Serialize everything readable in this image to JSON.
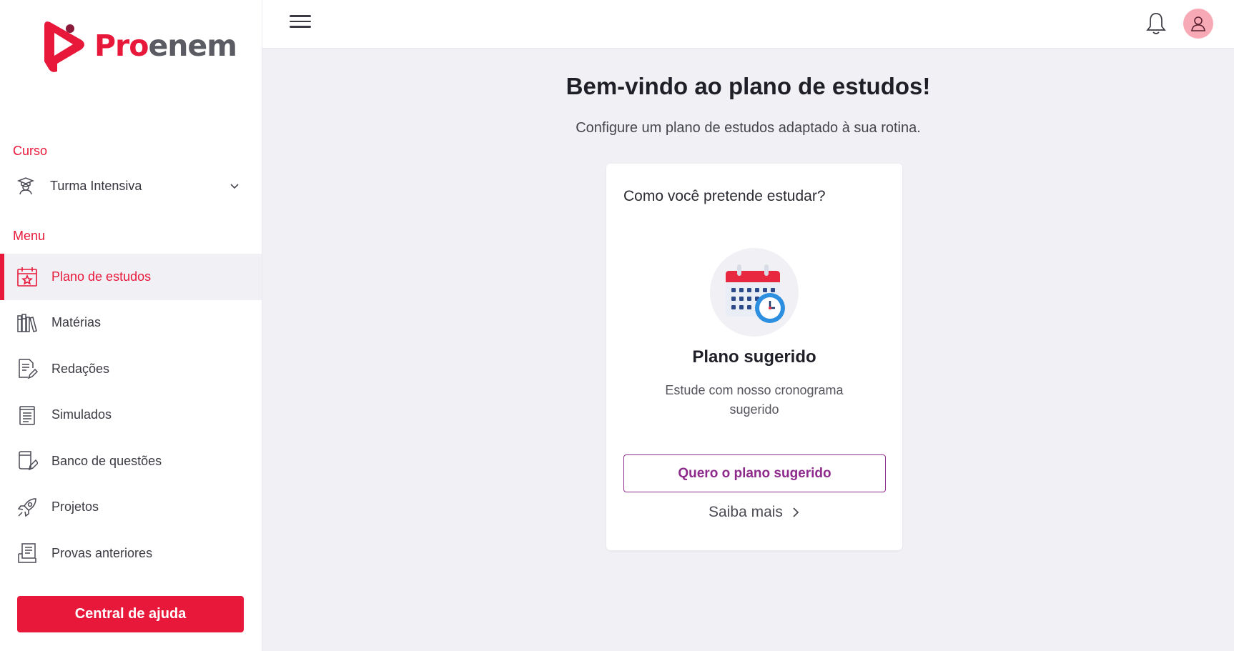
{
  "brand": {
    "name_part1": "Pro",
    "name_part2": "enem",
    "accent": "#e8183a",
    "secondary": "#8e2a8c"
  },
  "sidebar": {
    "course_section_label": "Curso",
    "course": {
      "label": "Turma Intensiva",
      "icon": "graduate-icon"
    },
    "menu_section_label": "Menu",
    "items": [
      {
        "label": "Plano de estudos",
        "icon": "calendar-star-icon",
        "active": true
      },
      {
        "label": "Matérias",
        "icon": "books-icon"
      },
      {
        "label": "Redações",
        "icon": "document-pen-icon"
      },
      {
        "label": "Simulados",
        "icon": "list-sheet-icon"
      },
      {
        "label": "Banco de questões",
        "icon": "notebook-pen-icon"
      },
      {
        "label": "Projetos",
        "icon": "rocket-icon"
      },
      {
        "label": "Provas anteriores",
        "icon": "archive-icon"
      }
    ],
    "help_button": "Central de ajuda"
  },
  "header": {
    "menu_icon": "hamburger-icon",
    "notification_icon": "bell-icon",
    "profile_icon": "user-icon"
  },
  "main": {
    "title": "Bem-vindo ao plano de estudos!",
    "subtitle": "Configure um plano de estudos adaptado à sua rotina.",
    "card": {
      "question": "Como você pretende estudar?",
      "illustration": "calendar-clock-icon",
      "heading": "Plano sugerido",
      "description": "Estude com nosso cronograma sugerido",
      "primary_button": "Quero o plano sugerido",
      "link": "Saiba mais"
    }
  }
}
